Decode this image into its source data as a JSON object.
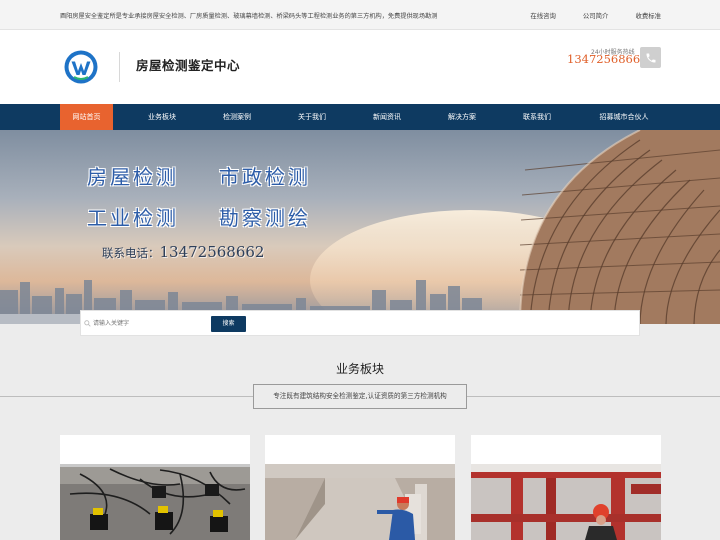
{
  "topbar": {
    "intro": "酉阳房屋安全鉴定所是专业承接房屋安全检测、厂房质量检测、玻璃幕墙检测、桥梁码头等工程检测业务的第三方机构，免费提供现场勘测",
    "links": [
      "在线咨询",
      "公司简介",
      "收费标准"
    ]
  },
  "header": {
    "site_name": "房屋检测鉴定中心",
    "hotline_label": "24小时服务热线",
    "hotline_number": "13472568662",
    "logo_icon": "w-logo-icon",
    "phone_icon": "phone-icon"
  },
  "nav": {
    "items": [
      "网站首页",
      "业务板块",
      "检测案例",
      "关于我们",
      "新闻资讯",
      "解决方案",
      "联系我们",
      "招募城市合伙人"
    ],
    "active_index": 0
  },
  "banner": {
    "line1_a": "房屋检测",
    "line1_b": "市政检测",
    "line2_a": "工业检测",
    "line2_b": "勘察测绘",
    "contact_label": "联系电话：",
    "contact_number": "13472568662"
  },
  "search": {
    "placeholder": "请输入关键字",
    "button": "搜索"
  },
  "section": {
    "title": "业务板块",
    "subtitle": "专注既有建筑结构安全检测鉴定,认证资质的第三方检测机构"
  },
  "colors": {
    "nav_bg": "#0e3a61",
    "accent": "#e8632f",
    "hotline": "#e0602a"
  }
}
